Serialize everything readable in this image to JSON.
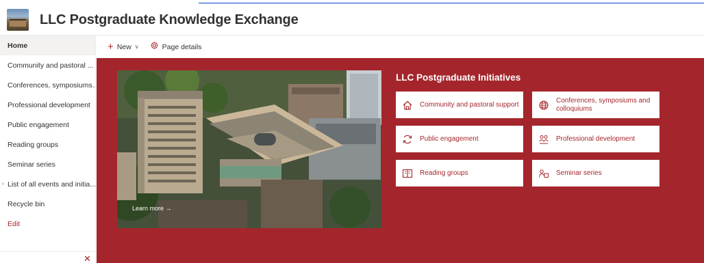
{
  "site": {
    "title": "LLC Postgraduate Knowledge Exchange"
  },
  "left_nav": {
    "items": [
      {
        "label": "Home",
        "selected": true
      },
      {
        "label": "Community and pastoral ..."
      },
      {
        "label": "Conferences, symposiums..."
      },
      {
        "label": "Professional development"
      },
      {
        "label": "Public engagement"
      },
      {
        "label": "Reading groups"
      },
      {
        "label": "Seminar series"
      },
      {
        "label": "List of all events and initia..."
      },
      {
        "label": "Recycle bin"
      },
      {
        "label": "Edit"
      }
    ],
    "close_glyph": "✕"
  },
  "command_bar": {
    "new_label": "New",
    "page_details_label": "Page details"
  },
  "hero": {
    "link_label": "Learn more →"
  },
  "initiatives": {
    "title": "LLC Postgraduate Initiatives",
    "tiles": [
      {
        "label": "Community and pastoral support",
        "icon": "home-icon"
      },
      {
        "label": "Conferences, symposiums and colloquiums",
        "icon": "globe-icon"
      },
      {
        "label": "Public engagement",
        "icon": "sync-icon"
      },
      {
        "label": "Professional development",
        "icon": "people-icon"
      },
      {
        "label": "Reading groups",
        "icon": "book-icon"
      },
      {
        "label": "Seminar series",
        "icon": "person-board-icon"
      }
    ]
  },
  "colors": {
    "accent": "#a4262c",
    "canvas": "#a4262c",
    "tile_background": "#ffffff"
  }
}
